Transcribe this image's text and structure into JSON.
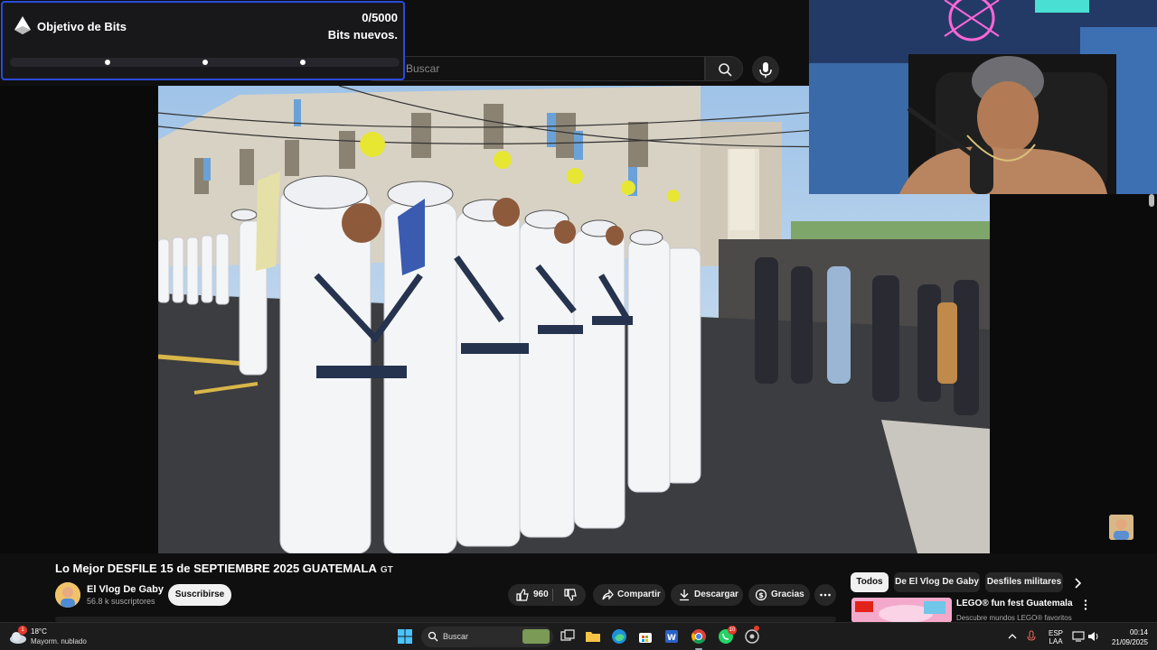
{
  "bits_goal": {
    "title": "Objetivo de Bits",
    "count": "0/5000",
    "subtitle": "Bits nuevos.",
    "progress": 0
  },
  "youtube": {
    "search_placeholder": "Buscar",
    "video": {
      "title": "Lo Mejor DESFILE 15 de SEPTIEMBRE 2025 GUATEMALA",
      "title_badge": "GT",
      "channel_name": "El Vlog De Gaby",
      "channel_subs": "56.8 k suscriptores",
      "subscribe_label": "Suscribirse",
      "likes": "960",
      "share_label": "Compartir",
      "download_label": "Descargar",
      "thanks_label": "Gracias"
    },
    "chips": [
      "Todos",
      "De El Vlog De Gaby",
      "Desfiles militares"
    ],
    "recommendation": {
      "title": "LEGO® fun fest Guatemala",
      "description": "Descubre mundos LEGO® favoritos"
    }
  },
  "taskbar": {
    "weather_temp": "18°C",
    "weather_desc": "Mayorm. nublado",
    "search_label": "Buscar",
    "lang_top": "ESP",
    "lang_bottom": "LAA",
    "time": "00:14",
    "date": "21/09/2025",
    "weather_badge": "1",
    "whatsapp_badge": "10"
  },
  "colors": {
    "bits_border": "#2b4bd8",
    "bits_fill": "#9147ff",
    "youtube_bg": "#0f0f0f",
    "taskbar_bg": "#1c1c1c"
  }
}
